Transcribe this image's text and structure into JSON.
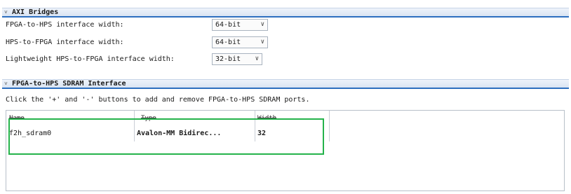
{
  "axi": {
    "title": "AXI Bridges",
    "fields": [
      {
        "label": "FPGA-to-HPS interface width:",
        "value": "64-bit"
      },
      {
        "label": "HPS-to-FPGA interface width:",
        "value": "64-bit"
      },
      {
        "label": "Lightweight HPS-to-FPGA interface width:",
        "value": "32-bit"
      }
    ]
  },
  "sdram": {
    "title": "FPGA-to-HPS SDRAM Interface",
    "hint": "Click the '+' and '-' buttons to add and remove FPGA-to-HPS SDRAM ports.",
    "columns": [
      "Name",
      "Type",
      "Width"
    ],
    "rows": [
      {
        "name": "f2h_sdram0",
        "type": "Avalon-MM Bidirec...",
        "width": "32"
      }
    ]
  },
  "icons": {
    "collapse": "chevron-down-icon",
    "dropdown": "chevron-down-icon"
  },
  "colors": {
    "header_underline": "#2e6fbf",
    "highlight_box": "#25b34b"
  }
}
